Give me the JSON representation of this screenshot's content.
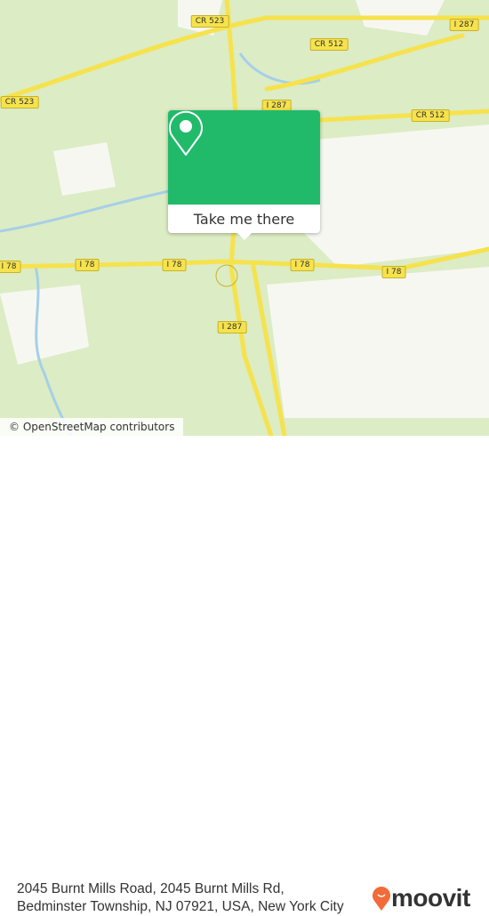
{
  "map": {
    "colors": {
      "land": "#dcecc4",
      "road": "#f6e24c",
      "water": "#a6cfe8",
      "accent": "#21ba6b",
      "brand": "#f26b3a"
    },
    "road_labels": [
      "CR 523",
      "CR 512",
      "I 287",
      "CR 523",
      "I 287",
      "CR 512",
      "I 78",
      "I 78",
      "I 78",
      "I 78",
      "I 78",
      "I 287"
    ],
    "attribution": "© OpenStreetMap contributors"
  },
  "popup": {
    "icon": "map-pin-icon",
    "button_label": "Take me there"
  },
  "footer": {
    "address_line1": "2045 Burnt Mills Road, 2045 Burnt Mills Rd,",
    "address_line2": "Bedminster Township, NJ 07921, USA, New York City",
    "logo_text": "moovit"
  }
}
